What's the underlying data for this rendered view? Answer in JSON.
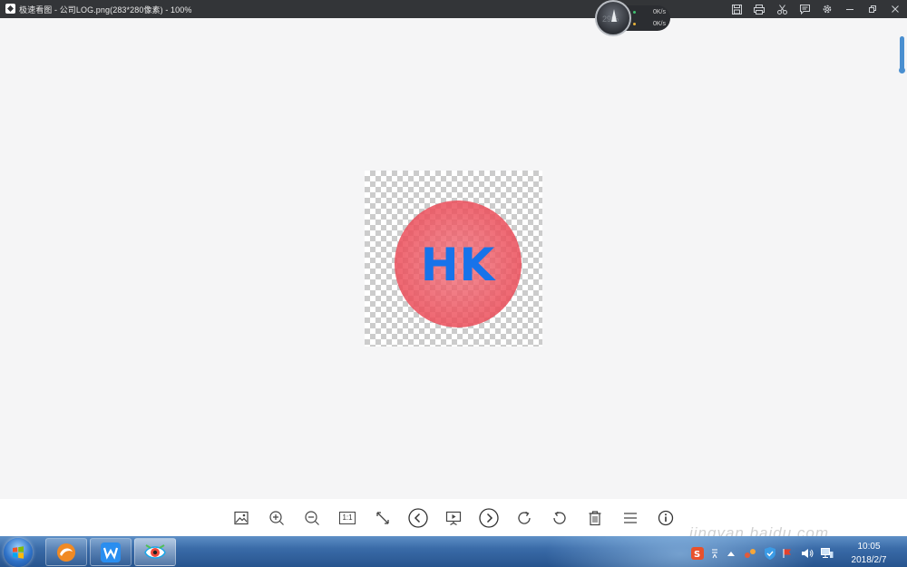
{
  "window": {
    "title": "极速看图 - 公司LOG.png(283*280像素) - 100%"
  },
  "speed_widget": {
    "percent": "29%",
    "upload": "0K/s",
    "download": "0K/s"
  },
  "image": {
    "logo_text": "HK",
    "logo_text_color": "#1773ea",
    "circle_color": "#ec5a66"
  },
  "toolbar": {
    "actual_size_label": "1:1"
  },
  "taskbar": {
    "time": "10:05",
    "date": "2018/2/7"
  },
  "watermark": "jingyan.baidu.com",
  "colors": {
    "titlebar": "#333538",
    "canvas": "#f5f5f6",
    "taskbar": "#3a6ba8"
  }
}
